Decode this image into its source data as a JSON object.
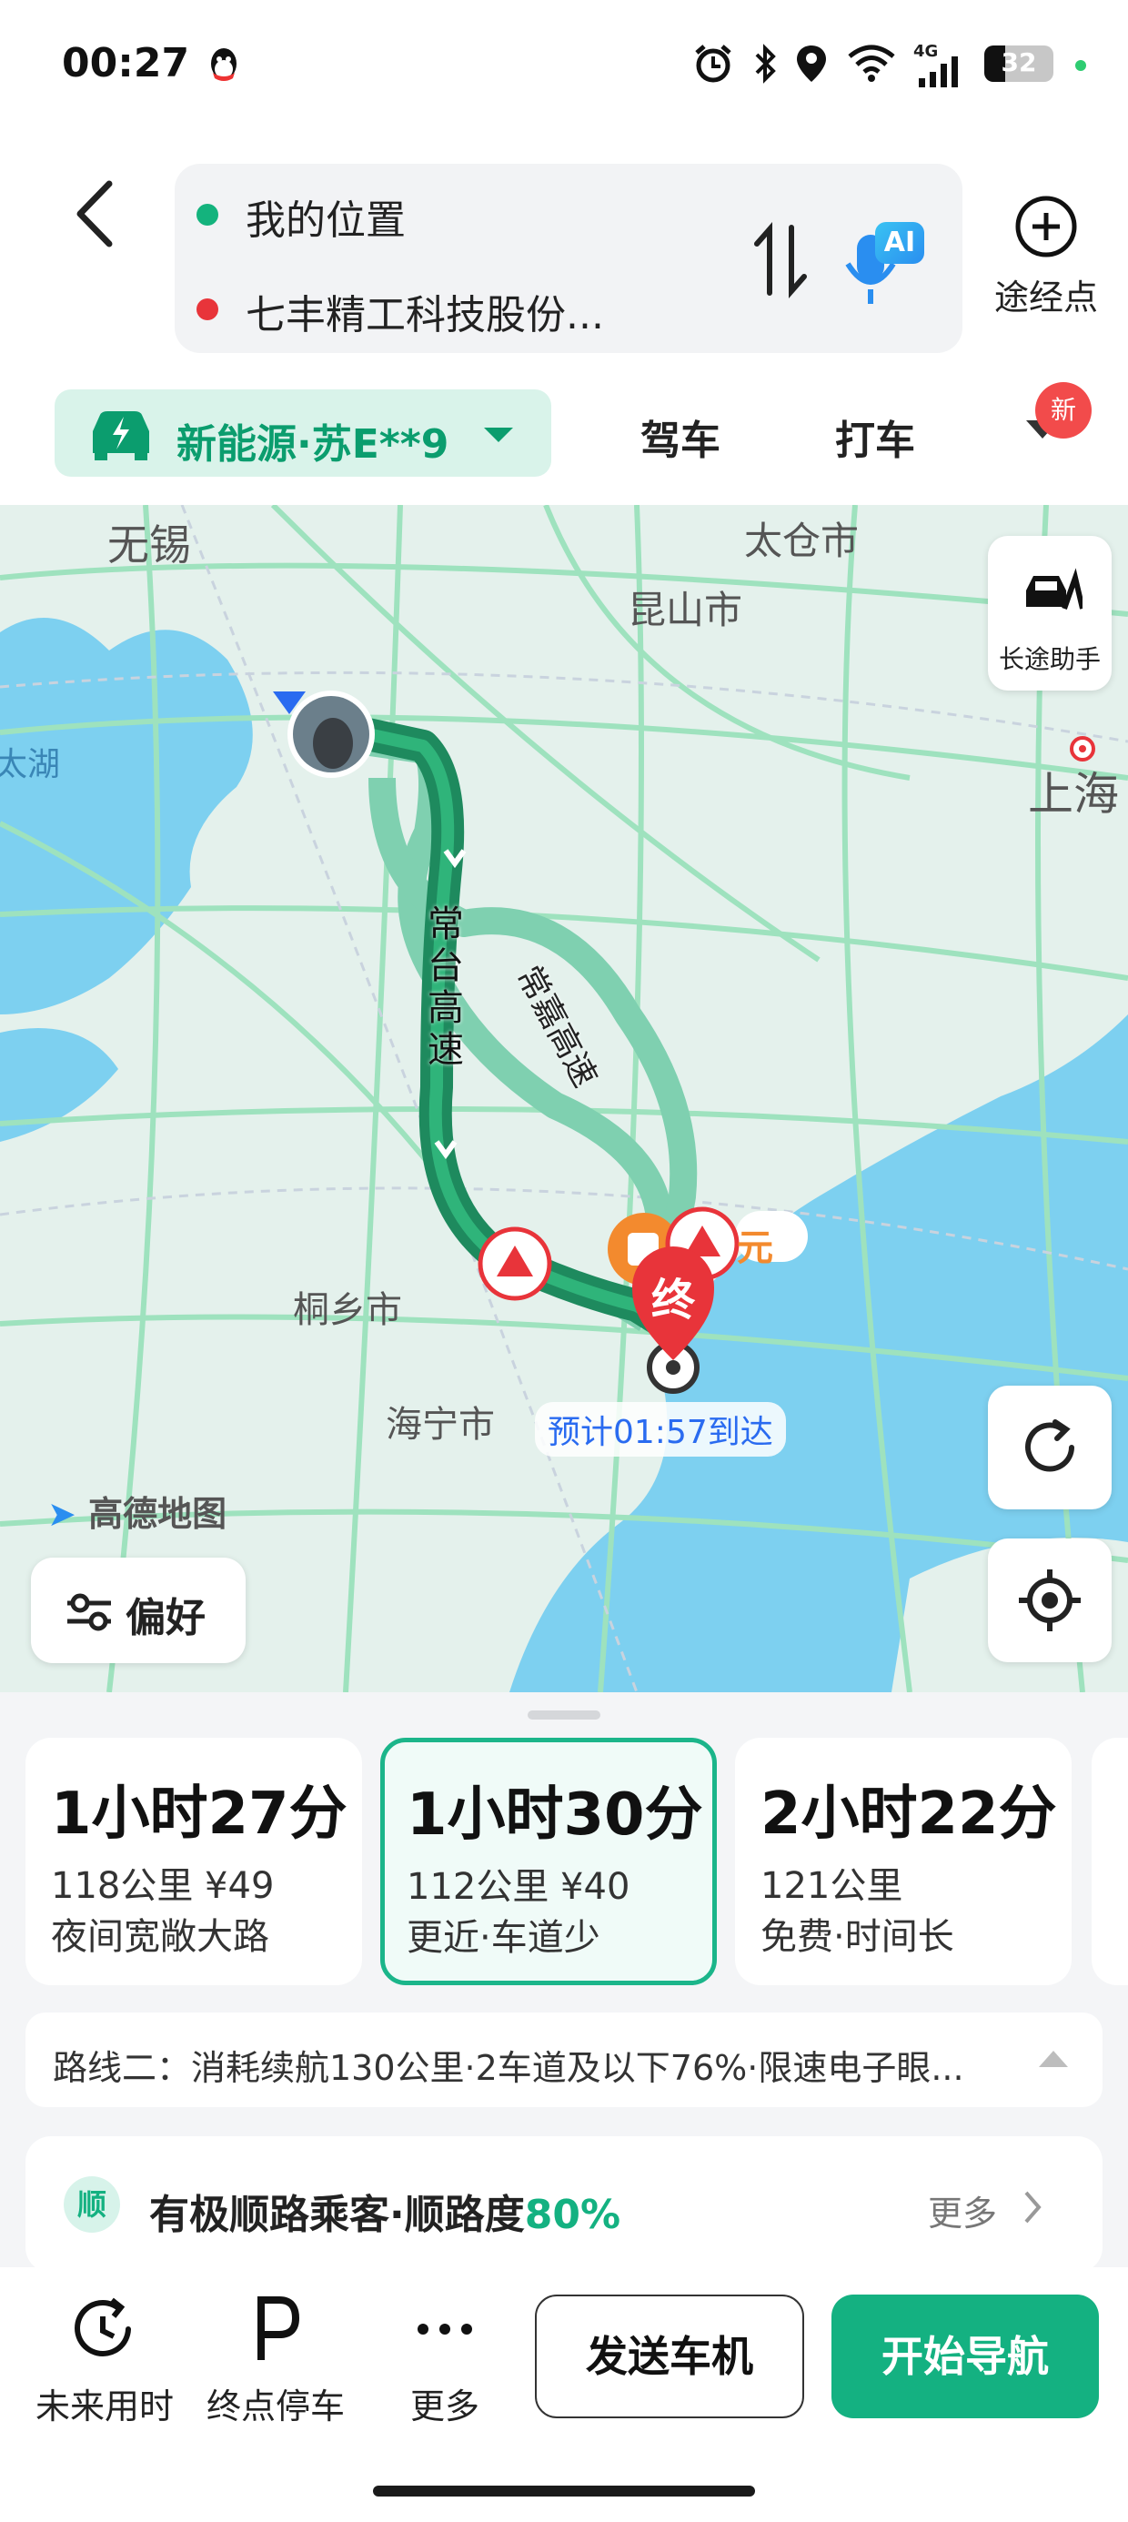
{
  "status_bar": {
    "time": "00:27",
    "battery": "32",
    "network": "4G",
    "icons": [
      "qq-icon",
      "alarm-icon",
      "bluetooth-icon",
      "location-icon",
      "wifi-icon",
      "signal-icon",
      "battery-icon"
    ]
  },
  "header": {
    "origin": "我的位置",
    "destination": "七丰精工科技股份...",
    "via_label": "途经点",
    "ai_badge": "AI",
    "colors": {
      "origin_dot": "#14b37d",
      "destination_dot": "#e8343a"
    }
  },
  "mode_bar": {
    "vehicle": "新能源·苏E**9",
    "tabs": [
      "驾车",
      "打车"
    ],
    "new_badge": "新"
  },
  "map": {
    "cities": [
      "无锡",
      "太仓市",
      "昆山市",
      "太湖",
      "上海",
      "桐乡市",
      "海宁市"
    ],
    "roads": [
      "常台高速",
      "常嘉高速"
    ],
    "eta_label": "预计01:57到达",
    "destination_marker": "终",
    "fee_label": "元",
    "logo_text": "高德地图",
    "long_trip_label": "长途助手",
    "preference_label": "偏好",
    "colors": {
      "route_main": "#1e8a5e",
      "route_alt": "#7fd0b0",
      "water": "#7dd0f0",
      "land": "#e4f1ec"
    }
  },
  "routes": [
    {
      "time": "1小时27分",
      "distance": "118公里  ¥49",
      "tag": "夜间宽敞大路",
      "selected": false
    },
    {
      "time": "1小时30分",
      "distance": "112公里  ¥40",
      "tag": "更近·车道少",
      "selected": true
    },
    {
      "time": "2小时22分",
      "distance": "121公里",
      "tag": "免费·时间长",
      "selected": false
    }
  ],
  "route_detail": "路线二：消耗续航130公里·2车道及以下76%·限速电子眼...",
  "passenger": {
    "badge": "顺",
    "text": "有极顺路乘客·顺路度",
    "percent": "80%",
    "more": "更多"
  },
  "bottom_bar": {
    "future_time": "未来用时",
    "parking": "终点停车",
    "more": "更多",
    "send_car": "发送车机",
    "start_nav": "开始导航",
    "accent": "#14b181"
  }
}
